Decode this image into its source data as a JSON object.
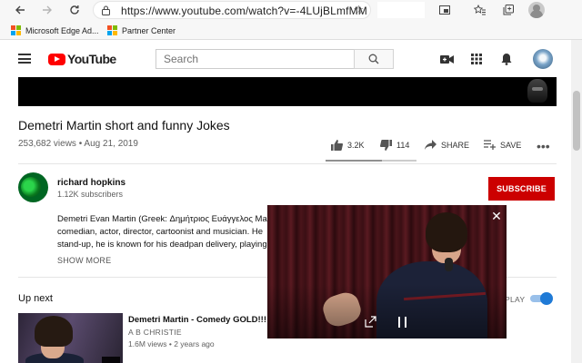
{
  "browser": {
    "url": "https://www.youtube.com/watch?v=-4LUjBLmfMM",
    "bookmarks": [
      {
        "label": "Microsoft Edge Ad..."
      },
      {
        "label": "Partner Center"
      }
    ]
  },
  "youtube": {
    "logo_text": "YouTube",
    "search_placeholder": "Search"
  },
  "video": {
    "title": "Demetri Martin short and funny Jokes",
    "views": "253,682 views",
    "date": "Aug 21, 2019",
    "meta": "253,682 views • Aug 21, 2019",
    "likes": "3.2K",
    "dislikes": "114",
    "like_ratio": 0.62,
    "share_label": "SHARE",
    "save_label": "SAVE"
  },
  "channel": {
    "name": "richard hopkins",
    "subscribers": "1.12K subscribers",
    "subscribe_label": "SUBSCRIBE"
  },
  "description": {
    "lines": [
      "Demetri Evan Martin (Greek: Δημήτριος Ευάγγελος Ma",
      "comedian, actor, director, cartoonist and musician. He",
      "stand-up, he is known for his deadpan delivery, playing"
    ],
    "show_more_label": "SHOW MORE"
  },
  "up_next": {
    "heading": "Up next",
    "autoplay_label": "PLAY",
    "autoplay_on": true,
    "items": [
      {
        "title": "Demetri Martin - Comedy GOLD!!!",
        "channel": "A B CHRISTIE",
        "meta": "1.6M views • 2 years ago"
      }
    ]
  },
  "colors": {
    "brand_red": "#ff0000",
    "subscribe_red": "#cc0000",
    "toggle_blue": "#1f7ad6"
  },
  "icons": [
    "back-arrow-icon",
    "forward-arrow-icon",
    "refresh-icon",
    "lock-icon",
    "favorite-star-icon",
    "favorites-list-icon",
    "collections-icon",
    "profile-icon",
    "menu-icon",
    "search-icon",
    "create-video-icon",
    "apps-grid-icon",
    "notifications-bell-icon",
    "thumbs-up-icon",
    "thumbs-down-icon",
    "share-icon",
    "add-to-playlist-icon",
    "more-actions-icon",
    "close-icon",
    "expand-icon",
    "pause-icon"
  ]
}
